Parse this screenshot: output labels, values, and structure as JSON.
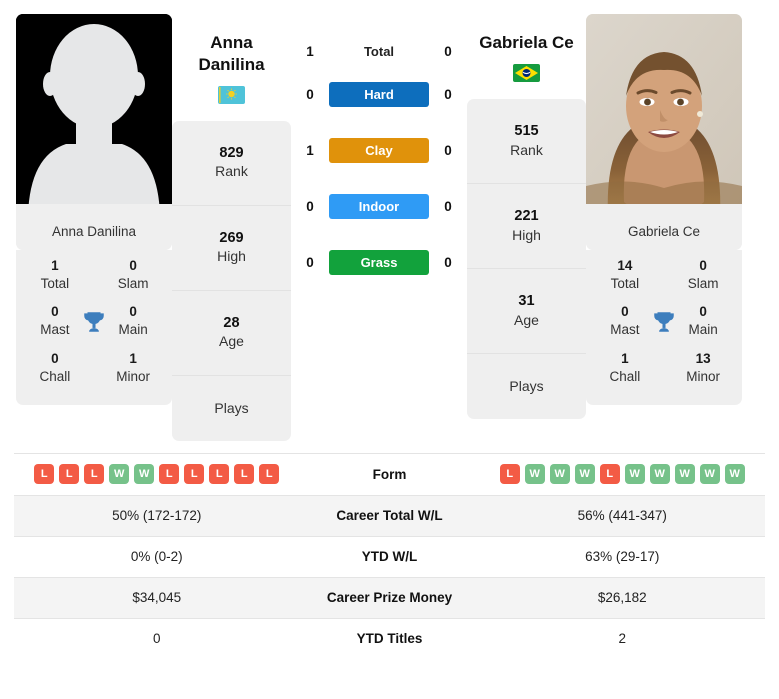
{
  "players": {
    "left": {
      "name_display": "Anna\nDanilina",
      "name_first": "Anna",
      "name_last": "Danilina",
      "photo_caption": "Anna Danilina",
      "photo_type": "avatar-placeholder",
      "country": "Kazakhstan",
      "flag": "kz-flag-icon",
      "rank": "829",
      "rank_label": "Rank",
      "high": "269",
      "high_label": "High",
      "age": "28",
      "age_label": "Age",
      "plays_label": "Plays",
      "plays_value": "",
      "titles": {
        "total": "1",
        "total_label": "Total",
        "slam": "0",
        "slam_label": "Slam",
        "mast": "0",
        "mast_label": "Mast",
        "main": "0",
        "main_label": "Main",
        "chall": "0",
        "chall_label": "Chall",
        "minor": "1",
        "minor_label": "Minor"
      },
      "form": [
        "L",
        "L",
        "L",
        "W",
        "W",
        "L",
        "L",
        "L",
        "L",
        "L"
      ],
      "career_total_wl": "50% (172-172)",
      "ytd_wl": "0% (0-2)",
      "career_prize_money": "$34,045",
      "ytd_titles": "0"
    },
    "right": {
      "name_display": "Gabriela Ce",
      "name_first": "Gabriela Ce",
      "name_last": "",
      "photo_caption": "Gabriela Ce",
      "photo_type": "portrait",
      "country": "Brazil",
      "flag": "br-flag-icon",
      "rank": "515",
      "rank_label": "Rank",
      "high": "221",
      "high_label": "High",
      "age": "31",
      "age_label": "Age",
      "plays_label": "Plays",
      "plays_value": "",
      "titles": {
        "total": "14",
        "total_label": "Total",
        "slam": "0",
        "slam_label": "Slam",
        "mast": "0",
        "mast_label": "Mast",
        "main": "0",
        "main_label": "Main",
        "chall": "1",
        "chall_label": "Chall",
        "minor": "13",
        "minor_label": "Minor"
      },
      "form": [
        "L",
        "W",
        "W",
        "W",
        "L",
        "W",
        "W",
        "W",
        "W",
        "W"
      ],
      "career_total_wl": "56% (441-347)",
      "ytd_wl": "63% (29-17)",
      "career_prize_money": "$26,182",
      "ytd_titles": "2"
    }
  },
  "h2h": [
    {
      "key": "total",
      "label": "Total",
      "left": "1",
      "right": "0",
      "color": ""
    },
    {
      "key": "hard",
      "label": "Hard",
      "left": "0",
      "right": "0",
      "color": "#0d6ebd"
    },
    {
      "key": "clay",
      "label": "Clay",
      "left": "1",
      "right": "0",
      "color": "#e0920b"
    },
    {
      "key": "indoor",
      "label": "Indoor",
      "left": "0",
      "right": "0",
      "color": "#2f9bf5"
    },
    {
      "key": "grass",
      "label": "Grass",
      "left": "0",
      "right": "0",
      "color": "#12a23c"
    }
  ],
  "table_rows": [
    {
      "label": "Form",
      "left": "",
      "right": "",
      "type": "form"
    },
    {
      "label": "Career Total W/L",
      "left": "50% (172-172)",
      "right": "56% (441-347)",
      "type": "text"
    },
    {
      "label": "YTD W/L",
      "left": "0% (0-2)",
      "right": "63% (29-17)",
      "type": "text"
    },
    {
      "label": "Career Prize Money",
      "left": "$34,045",
      "right": "$26,182",
      "type": "text"
    },
    {
      "label": "YTD Titles",
      "left": "0",
      "right": "2",
      "type": "text"
    }
  ],
  "colors": {
    "hard": "#0d6ebd",
    "clay": "#e0920b",
    "indoor": "#2f9bf5",
    "grass": "#12a23c",
    "win_badge": "#76c28a",
    "loss_badge": "#f35b45",
    "card_bg": "#efefef",
    "trophy": "#3d7ebd"
  },
  "icons": {
    "trophy": "trophy-icon"
  }
}
